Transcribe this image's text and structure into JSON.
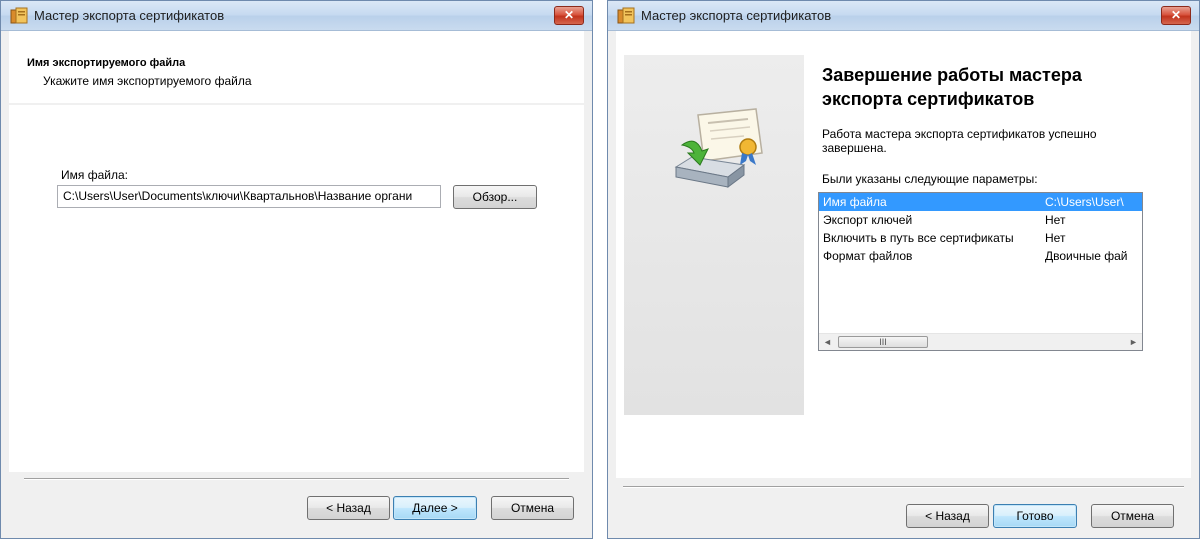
{
  "left_window": {
    "title": "Мастер экспорта сертификатов",
    "close_glyph": "✕",
    "header_title": "Имя экспортируемого файла",
    "header_subtitle": "Укажите имя экспортируемого файла",
    "file_label": "Имя файла:",
    "file_value": "C:\\Users\\User\\Documents\\ключи\\Квартальнов\\Название органи",
    "browse_button": "Обзор...",
    "back_button": "< Назад",
    "next_button": "Далее >",
    "cancel_button": "Отмена"
  },
  "right_window": {
    "title": "Мастер экспорта сертификатов",
    "close_glyph": "✕",
    "heading": "Завершение работы мастера экспорта сертификатов",
    "success_text": "Работа мастера экспорта сертификатов успешно завершена.",
    "params_label": "Были указаны следующие параметры:",
    "params": [
      {
        "name": "Имя файла",
        "value": "C:\\Users\\User\\"
      },
      {
        "name": "Экспорт ключей",
        "value": "Нет"
      },
      {
        "name": "Включить в путь все сертификаты",
        "value": "Нет"
      },
      {
        "name": "Формат файлов",
        "value": "Двоичные фай"
      }
    ],
    "scroll_left": "◄",
    "scroll_right": "►",
    "scroll_grip": "III",
    "back_button": "< Назад",
    "finish_button": "Готово",
    "cancel_button": "Отмена"
  },
  "colors": {
    "selection": "#3399ff",
    "default_button_border": "#3c7fb1",
    "close_button": "#c2331d"
  },
  "icons": [
    "certificate-wizard-icon",
    "certificate-export-icon",
    "close-icon"
  ]
}
